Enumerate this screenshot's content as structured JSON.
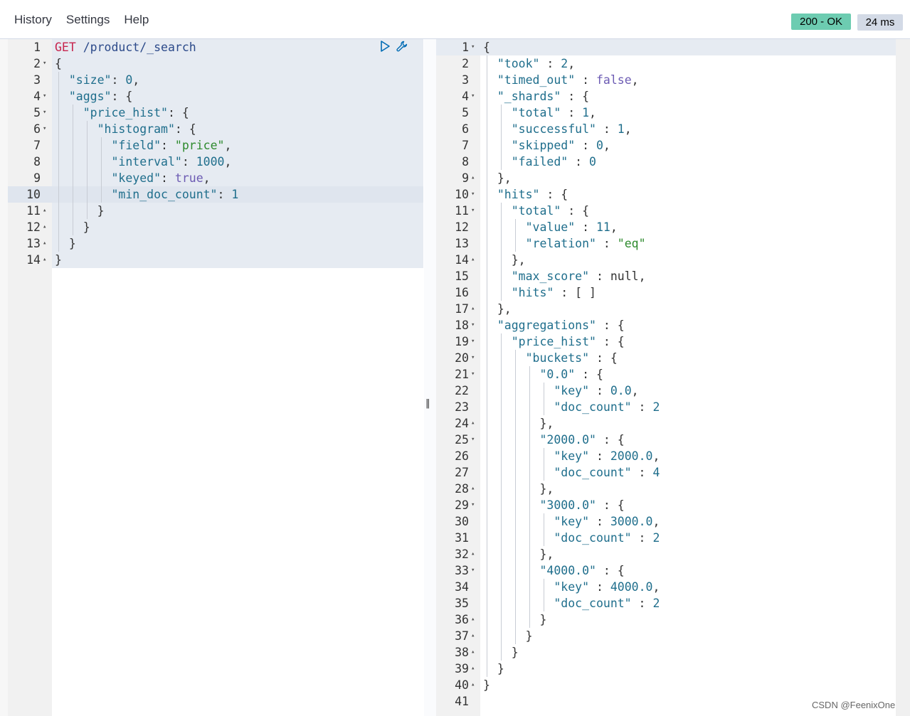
{
  "menu": {
    "history": "History",
    "settings": "Settings",
    "help": "Help"
  },
  "status": {
    "code_text": "200 - OK",
    "time_text": "24 ms",
    "ok_color": "#6dccb1"
  },
  "request": {
    "active_line": 10,
    "lines": [
      {
        "n": "1",
        "fold": "",
        "html": [
          [
            "t-method",
            "GET"
          ],
          [
            "t-punc",
            " "
          ],
          [
            "t-url",
            "/product/_search"
          ]
        ]
      },
      {
        "n": "2",
        "fold": "▾",
        "html": [
          [
            "t-punc",
            "{"
          ]
        ]
      },
      {
        "n": "3",
        "fold": "",
        "html": [
          [
            "t-punc",
            "  "
          ],
          [
            "t-key",
            "\"size\""
          ],
          [
            "t-punc",
            ": "
          ],
          [
            "t-num",
            "0"
          ],
          [
            "t-punc",
            ","
          ]
        ]
      },
      {
        "n": "4",
        "fold": "▾",
        "html": [
          [
            "t-punc",
            "  "
          ],
          [
            "t-key",
            "\"aggs\""
          ],
          [
            "t-punc",
            ": {"
          ]
        ]
      },
      {
        "n": "5",
        "fold": "▾",
        "html": [
          [
            "t-punc",
            "    "
          ],
          [
            "t-key",
            "\"price_hist\""
          ],
          [
            "t-punc",
            ": {"
          ]
        ]
      },
      {
        "n": "6",
        "fold": "▾",
        "html": [
          [
            "t-punc",
            "      "
          ],
          [
            "t-key",
            "\"histogram\""
          ],
          [
            "t-punc",
            ": {"
          ]
        ]
      },
      {
        "n": "7",
        "fold": "",
        "html": [
          [
            "t-punc",
            "        "
          ],
          [
            "t-key",
            "\"field\""
          ],
          [
            "t-punc",
            ": "
          ],
          [
            "t-str",
            "\"price\""
          ],
          [
            "t-punc",
            ","
          ]
        ]
      },
      {
        "n": "8",
        "fold": "",
        "html": [
          [
            "t-punc",
            "        "
          ],
          [
            "t-key",
            "\"interval\""
          ],
          [
            "t-punc",
            ": "
          ],
          [
            "t-num",
            "1000"
          ],
          [
            "t-punc",
            ","
          ]
        ]
      },
      {
        "n": "9",
        "fold": "",
        "html": [
          [
            "t-punc",
            "        "
          ],
          [
            "t-key",
            "\"keyed\""
          ],
          [
            "t-punc",
            ": "
          ],
          [
            "t-bool",
            "true"
          ],
          [
            "t-punc",
            ","
          ]
        ]
      },
      {
        "n": "10",
        "fold": "",
        "html": [
          [
            "t-punc",
            "        "
          ],
          [
            "t-key",
            "\"min_doc_count\""
          ],
          [
            "t-punc",
            ": "
          ],
          [
            "t-num",
            "1"
          ]
        ]
      },
      {
        "n": "11",
        "fold": "▴",
        "html": [
          [
            "t-punc",
            "      }"
          ]
        ]
      },
      {
        "n": "12",
        "fold": "▴",
        "html": [
          [
            "t-punc",
            "    }"
          ]
        ]
      },
      {
        "n": "13",
        "fold": "▴",
        "html": [
          [
            "t-punc",
            "  }"
          ]
        ]
      },
      {
        "n": "14",
        "fold": "▴",
        "html": [
          [
            "t-punc",
            "}"
          ]
        ]
      }
    ]
  },
  "response": {
    "lines": [
      {
        "n": "1",
        "fold": "▾",
        "html": [
          [
            "t-punc",
            "{"
          ]
        ]
      },
      {
        "n": "2",
        "fold": "",
        "html": [
          [
            "t-punc",
            "  "
          ],
          [
            "t-key",
            "\"took\""
          ],
          [
            "t-punc",
            " : "
          ],
          [
            "t-num",
            "2"
          ],
          [
            "t-punc",
            ","
          ]
        ]
      },
      {
        "n": "3",
        "fold": "",
        "html": [
          [
            "t-punc",
            "  "
          ],
          [
            "t-key",
            "\"timed_out\""
          ],
          [
            "t-punc",
            " : "
          ],
          [
            "t-bool",
            "false"
          ],
          [
            "t-punc",
            ","
          ]
        ]
      },
      {
        "n": "4",
        "fold": "▾",
        "html": [
          [
            "t-punc",
            "  "
          ],
          [
            "t-key",
            "\"_shards\""
          ],
          [
            "t-punc",
            " : {"
          ]
        ]
      },
      {
        "n": "5",
        "fold": "",
        "html": [
          [
            "t-punc",
            "    "
          ],
          [
            "t-key",
            "\"total\""
          ],
          [
            "t-punc",
            " : "
          ],
          [
            "t-num",
            "1"
          ],
          [
            "t-punc",
            ","
          ]
        ]
      },
      {
        "n": "6",
        "fold": "",
        "html": [
          [
            "t-punc",
            "    "
          ],
          [
            "t-key",
            "\"successful\""
          ],
          [
            "t-punc",
            " : "
          ],
          [
            "t-num",
            "1"
          ],
          [
            "t-punc",
            ","
          ]
        ]
      },
      {
        "n": "7",
        "fold": "",
        "html": [
          [
            "t-punc",
            "    "
          ],
          [
            "t-key",
            "\"skipped\""
          ],
          [
            "t-punc",
            " : "
          ],
          [
            "t-num",
            "0"
          ],
          [
            "t-punc",
            ","
          ]
        ]
      },
      {
        "n": "8",
        "fold": "",
        "html": [
          [
            "t-punc",
            "    "
          ],
          [
            "t-key",
            "\"failed\""
          ],
          [
            "t-punc",
            " : "
          ],
          [
            "t-num",
            "0"
          ]
        ]
      },
      {
        "n": "9",
        "fold": "▴",
        "html": [
          [
            "t-punc",
            "  },"
          ]
        ]
      },
      {
        "n": "10",
        "fold": "▾",
        "html": [
          [
            "t-punc",
            "  "
          ],
          [
            "t-key",
            "\"hits\""
          ],
          [
            "t-punc",
            " : {"
          ]
        ]
      },
      {
        "n": "11",
        "fold": "▾",
        "html": [
          [
            "t-punc",
            "    "
          ],
          [
            "t-key",
            "\"total\""
          ],
          [
            "t-punc",
            " : {"
          ]
        ]
      },
      {
        "n": "12",
        "fold": "",
        "html": [
          [
            "t-punc",
            "      "
          ],
          [
            "t-key",
            "\"value\""
          ],
          [
            "t-punc",
            " : "
          ],
          [
            "t-num",
            "11"
          ],
          [
            "t-punc",
            ","
          ]
        ]
      },
      {
        "n": "13",
        "fold": "",
        "html": [
          [
            "t-punc",
            "      "
          ],
          [
            "t-key",
            "\"relation\""
          ],
          [
            "t-punc",
            " : "
          ],
          [
            "t-str",
            "\"eq\""
          ]
        ]
      },
      {
        "n": "14",
        "fold": "▴",
        "html": [
          [
            "t-punc",
            "    },"
          ]
        ]
      },
      {
        "n": "15",
        "fold": "",
        "html": [
          [
            "t-punc",
            "    "
          ],
          [
            "t-key",
            "\"max_score\""
          ],
          [
            "t-punc",
            " : "
          ],
          [
            "t-null",
            "null"
          ],
          [
            "t-punc",
            ","
          ]
        ]
      },
      {
        "n": "16",
        "fold": "",
        "html": [
          [
            "t-punc",
            "    "
          ],
          [
            "t-key",
            "\"hits\""
          ],
          [
            "t-punc",
            " : [ ]"
          ]
        ]
      },
      {
        "n": "17",
        "fold": "▴",
        "html": [
          [
            "t-punc",
            "  },"
          ]
        ]
      },
      {
        "n": "18",
        "fold": "▾",
        "html": [
          [
            "t-punc",
            "  "
          ],
          [
            "t-key",
            "\"aggregations\""
          ],
          [
            "t-punc",
            " : {"
          ]
        ]
      },
      {
        "n": "19",
        "fold": "▾",
        "html": [
          [
            "t-punc",
            "    "
          ],
          [
            "t-key",
            "\"price_hist\""
          ],
          [
            "t-punc",
            " : {"
          ]
        ]
      },
      {
        "n": "20",
        "fold": "▾",
        "html": [
          [
            "t-punc",
            "      "
          ],
          [
            "t-key",
            "\"buckets\""
          ],
          [
            "t-punc",
            " : {"
          ]
        ]
      },
      {
        "n": "21",
        "fold": "▾",
        "html": [
          [
            "t-punc",
            "        "
          ],
          [
            "t-key",
            "\"0.0\""
          ],
          [
            "t-punc",
            " : {"
          ]
        ]
      },
      {
        "n": "22",
        "fold": "",
        "html": [
          [
            "t-punc",
            "          "
          ],
          [
            "t-key",
            "\"key\""
          ],
          [
            "t-punc",
            " : "
          ],
          [
            "t-num",
            "0.0"
          ],
          [
            "t-punc",
            ","
          ]
        ]
      },
      {
        "n": "23",
        "fold": "",
        "html": [
          [
            "t-punc",
            "          "
          ],
          [
            "t-key",
            "\"doc_count\""
          ],
          [
            "t-punc",
            " : "
          ],
          [
            "t-num",
            "2"
          ]
        ]
      },
      {
        "n": "24",
        "fold": "▴",
        "html": [
          [
            "t-punc",
            "        },"
          ]
        ]
      },
      {
        "n": "25",
        "fold": "▾",
        "html": [
          [
            "t-punc",
            "        "
          ],
          [
            "t-key",
            "\"2000.0\""
          ],
          [
            "t-punc",
            " : {"
          ]
        ]
      },
      {
        "n": "26",
        "fold": "",
        "html": [
          [
            "t-punc",
            "          "
          ],
          [
            "t-key",
            "\"key\""
          ],
          [
            "t-punc",
            " : "
          ],
          [
            "t-num",
            "2000.0"
          ],
          [
            "t-punc",
            ","
          ]
        ]
      },
      {
        "n": "27",
        "fold": "",
        "html": [
          [
            "t-punc",
            "          "
          ],
          [
            "t-key",
            "\"doc_count\""
          ],
          [
            "t-punc",
            " : "
          ],
          [
            "t-num",
            "4"
          ]
        ]
      },
      {
        "n": "28",
        "fold": "▴",
        "html": [
          [
            "t-punc",
            "        },"
          ]
        ]
      },
      {
        "n": "29",
        "fold": "▾",
        "html": [
          [
            "t-punc",
            "        "
          ],
          [
            "t-key",
            "\"3000.0\""
          ],
          [
            "t-punc",
            " : {"
          ]
        ]
      },
      {
        "n": "30",
        "fold": "",
        "html": [
          [
            "t-punc",
            "          "
          ],
          [
            "t-key",
            "\"key\""
          ],
          [
            "t-punc",
            " : "
          ],
          [
            "t-num",
            "3000.0"
          ],
          [
            "t-punc",
            ","
          ]
        ]
      },
      {
        "n": "31",
        "fold": "",
        "html": [
          [
            "t-punc",
            "          "
          ],
          [
            "t-key",
            "\"doc_count\""
          ],
          [
            "t-punc",
            " : "
          ],
          [
            "t-num",
            "2"
          ]
        ]
      },
      {
        "n": "32",
        "fold": "▴",
        "html": [
          [
            "t-punc",
            "        },"
          ]
        ]
      },
      {
        "n": "33",
        "fold": "▾",
        "html": [
          [
            "t-punc",
            "        "
          ],
          [
            "t-key",
            "\"4000.0\""
          ],
          [
            "t-punc",
            " : {"
          ]
        ]
      },
      {
        "n": "34",
        "fold": "",
        "html": [
          [
            "t-punc",
            "          "
          ],
          [
            "t-key",
            "\"key\""
          ],
          [
            "t-punc",
            " : "
          ],
          [
            "t-num",
            "4000.0"
          ],
          [
            "t-punc",
            ","
          ]
        ]
      },
      {
        "n": "35",
        "fold": "",
        "html": [
          [
            "t-punc",
            "          "
          ],
          [
            "t-key",
            "\"doc_count\""
          ],
          [
            "t-punc",
            " : "
          ],
          [
            "t-num",
            "2"
          ]
        ]
      },
      {
        "n": "36",
        "fold": "▴",
        "html": [
          [
            "t-punc",
            "        }"
          ]
        ]
      },
      {
        "n": "37",
        "fold": "▴",
        "html": [
          [
            "t-punc",
            "      }"
          ]
        ]
      },
      {
        "n": "38",
        "fold": "▴",
        "html": [
          [
            "t-punc",
            "    }"
          ]
        ]
      },
      {
        "n": "39",
        "fold": "▴",
        "html": [
          [
            "t-punc",
            "  }"
          ]
        ]
      },
      {
        "n": "40",
        "fold": "▴",
        "html": [
          [
            "t-punc",
            "}"
          ]
        ]
      },
      {
        "n": "41",
        "fold": "",
        "html": []
      }
    ]
  },
  "actions": {
    "run_icon": "play-icon",
    "settings_icon": "wrench-icon"
  },
  "splitter": {
    "handle": "‖"
  },
  "watermark": "CSDN @FeenixOne"
}
